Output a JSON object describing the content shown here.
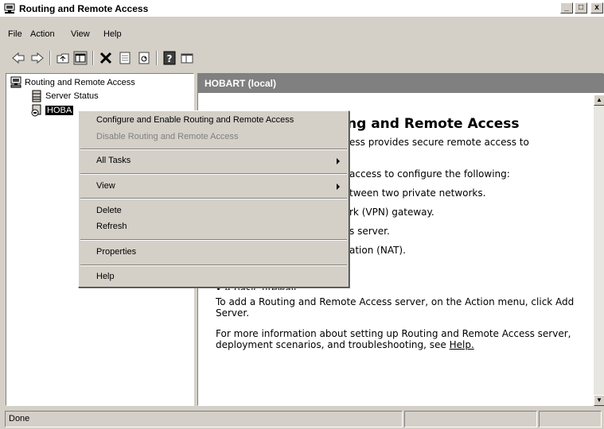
{
  "window": {
    "title": "Routing and Remote Access",
    "controls": {
      "minimize": "_",
      "maximize": "□",
      "close": "x"
    }
  },
  "menubar": {
    "items": [
      "File",
      "Action",
      "View",
      "Help"
    ]
  },
  "toolbar": {
    "icons": [
      "back-arrow-icon",
      "forward-arrow-icon",
      "up-folder-icon",
      "show-hide-tree-icon",
      "delete-icon",
      "properties-icon",
      "refresh-icon",
      "help-icon",
      "console-icon"
    ]
  },
  "tree": {
    "root": "Routing and Remote Access",
    "items": [
      "Server Status",
      "HOBA"
    ]
  },
  "right_pane": {
    "header": "HOBART (local)",
    "heading": "ng and Remote Access",
    "lines": [
      "ess provides secure remote access to",
      "access to configure the following:",
      "tween two private networks.",
      "rk (VPN) gateway.",
      "s server.",
      "ation (NAT)."
    ],
    "bullet_partial": "• A basic firewall.",
    "para_add": "To add a Routing and Remote Access server, on the Action menu, click Add Server.",
    "para_more_prefix": "For more information about setting up Routing and Remote Access server, deployment scenarios, and troubleshooting, see ",
    "help_link": "Help."
  },
  "context_menu": {
    "items": [
      {
        "label": "Configure and Enable Routing and Remote Access",
        "disabled": false
      },
      {
        "label": "Disable Routing and Remote Access",
        "disabled": true
      },
      {
        "label": "All Tasks",
        "submenu": true
      },
      {
        "label": "View",
        "submenu": true
      },
      {
        "label": "Delete"
      },
      {
        "label": "Refresh"
      },
      {
        "label": "Properties"
      },
      {
        "label": "Help"
      }
    ]
  },
  "statusbar": {
    "text": "Done"
  }
}
